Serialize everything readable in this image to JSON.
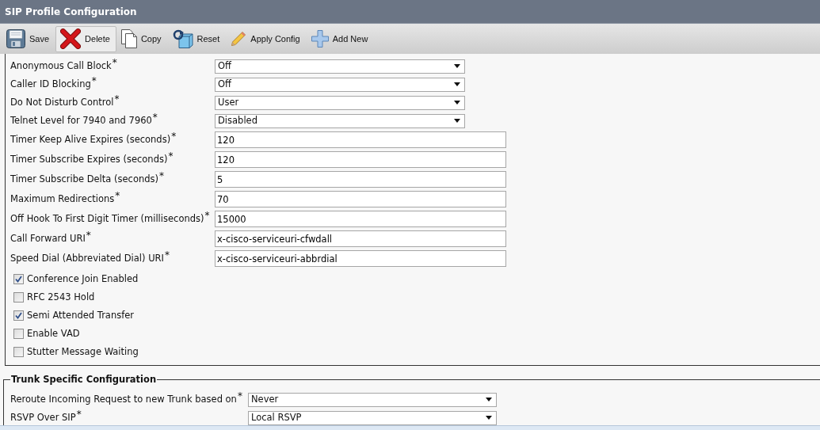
{
  "window": {
    "title": "SIP Profile Configuration"
  },
  "toolbar": [
    {
      "kind": "save",
      "label": "Save",
      "hovered": false
    },
    {
      "kind": "delete",
      "label": "Delete",
      "hovered": true
    },
    {
      "kind": "copy",
      "label": "Copy",
      "hovered": false
    },
    {
      "kind": "reset",
      "label": "Reset",
      "hovered": false
    },
    {
      "kind": "apply",
      "label": "Apply Config",
      "hovered": false
    },
    {
      "kind": "add",
      "label": "Add New",
      "hovered": false
    }
  ],
  "fields": [
    {
      "kind": "select",
      "label": "Anonymous Call Block$^{*}$",
      "value": "Off"
    },
    {
      "kind": "select",
      "label": "Caller ID Blocking$^{*}$",
      "value": "Off"
    },
    {
      "kind": "select",
      "label": "Do Not Disturb Control$^{*}$",
      "value": "User"
    },
    {
      "kind": "select",
      "label": "Telnet Level for 7940 and 7960$^{*}$",
      "value": "Disabled"
    },
    {
      "kind": "text",
      "label": "Timer Keep Alive Expires (seconds)$^{*}$",
      "value": "120"
    },
    {
      "kind": "text",
      "label": "Timer Subscribe Expires (seconds)$^{*}$",
      "value": "120"
    },
    {
      "kind": "text",
      "label": "Timer Subscribe Delta (seconds)$^{*}$",
      "value": "5"
    },
    {
      "kind": "text",
      "label": "Maximum Redirections$^{*}$",
      "value": "70"
    },
    {
      "kind": "text",
      "label": "Off Hook To First Digit Timer (milliseconds)$^{*}$",
      "value": "15000"
    },
    {
      "kind": "text",
      "label": "Call Forward URI$^{*}$",
      "value": "x-cisco-serviceuri-cfwdall"
    },
    {
      "kind": "text",
      "label": "Speed Dial (Abbreviated Dial) URI$^{*}$",
      "value": "x-cisco-serviceuri-abbrdial"
    }
  ],
  "checkboxes": [
    {
      "label": "Conference Join Enabled",
      "checked": true
    },
    {
      "label": "RFC 2543 Hold",
      "checked": false
    },
    {
      "label": "Semi Attended Transfer",
      "checked": true
    },
    {
      "label": "Enable VAD",
      "checked": false
    },
    {
      "label": "Stutter Message Waiting",
      "checked": false
    }
  ],
  "trunk_section": {
    "title": "Trunk Specific Configuration",
    "fields": [
      {
        "kind": "select",
        "label": "Reroute Incoming Request to new Trunk based on$^{*}$",
        "value": "Never"
      },
      {
        "kind": "select",
        "label": "RSVP Over SIP$^{*}$",
        "value": "Local RSVP"
      }
    ]
  }
}
